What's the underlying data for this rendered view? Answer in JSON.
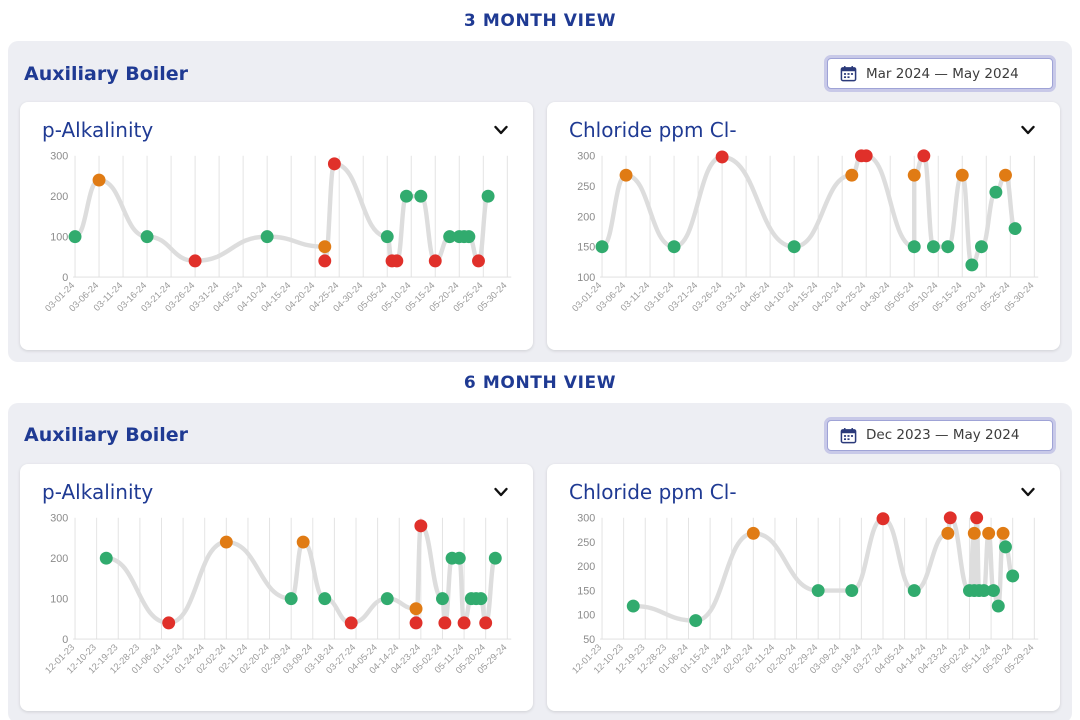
{
  "sections": [
    {
      "heading": "3 MONTH VIEW",
      "panel_title": "Auxiliary Boiler",
      "date_range": "Mar 2024 — May 2024",
      "charts": [
        {
          "title": "p-Alkalinity",
          "chevron": "chevron-down",
          "chart_data": {
            "type": "line",
            "title": "p-Alkalinity",
            "xlabel": "",
            "ylabel": "",
            "ylim": [
              0,
              300
            ],
            "yticks": [
              0,
              100,
              200,
              300
            ],
            "grid": true,
            "legend": "none",
            "xticks": [
              "03-01-24",
              "03-06-24",
              "03-11-24",
              "03-16-24",
              "03-21-24",
              "03-26-24",
              "03-31-24",
              "04-05-24",
              "04-10-24",
              "04-15-24",
              "04-20-24",
              "04-25-24",
              "04-30-24",
              "05-05-24",
              "05-10-24",
              "05-15-24",
              "05-20-24",
              "05-25-24",
              "05-30-24"
            ],
            "points": [
              {
                "x": "03-01-24",
                "y": 100,
                "status": "ok"
              },
              {
                "x": "03-06-24",
                "y": 240,
                "status": "warn"
              },
              {
                "x": "03-16-24",
                "y": 100,
                "status": "ok"
              },
              {
                "x": "03-26-24",
                "y": 40,
                "status": "alert"
              },
              {
                "x": "04-10-24",
                "y": 100,
                "status": "ok"
              },
              {
                "x": "04-22-24",
                "y": 75,
                "status": "warn"
              },
              {
                "x": "04-22-24",
                "y": 40,
                "status": "alert"
              },
              {
                "x": "04-24-24",
                "y": 280,
                "status": "alert"
              },
              {
                "x": "05-05-24",
                "y": 100,
                "status": "ok"
              },
              {
                "x": "05-06-24",
                "y": 40,
                "status": "alert"
              },
              {
                "x": "05-07-24",
                "y": 40,
                "status": "alert"
              },
              {
                "x": "05-09-24",
                "y": 200,
                "status": "ok"
              },
              {
                "x": "05-12-24",
                "y": 200,
                "status": "ok"
              },
              {
                "x": "05-15-24",
                "y": 40,
                "status": "alert"
              },
              {
                "x": "05-18-24",
                "y": 100,
                "status": "ok"
              },
              {
                "x": "05-20-24",
                "y": 100,
                "status": "ok"
              },
              {
                "x": "05-21-24",
                "y": 100,
                "status": "ok"
              },
              {
                "x": "05-22-24",
                "y": 100,
                "status": "ok"
              },
              {
                "x": "05-24-24",
                "y": 40,
                "status": "alert"
              },
              {
                "x": "05-26-24",
                "y": 200,
                "status": "ok"
              }
            ]
          }
        },
        {
          "title": "Chloride ppm Cl-",
          "chevron": "chevron-down",
          "chart_data": {
            "type": "line",
            "title": "Chloride ppm Cl-",
            "xlabel": "",
            "ylabel": "",
            "ylim": [
              100,
              300
            ],
            "yticks": [
              100,
              150,
              200,
              250,
              300
            ],
            "grid": true,
            "legend": "none",
            "xticks": [
              "03-01-24",
              "03-06-24",
              "03-11-24",
              "03-16-24",
              "03-21-24",
              "03-26-24",
              "03-31-24",
              "04-05-24",
              "04-10-24",
              "04-15-24",
              "04-20-24",
              "04-25-24",
              "04-30-24",
              "05-05-24",
              "05-10-24",
              "05-15-24",
              "05-20-24",
              "05-25-24",
              "05-30-24"
            ],
            "points": [
              {
                "x": "03-01-24",
                "y": 150,
                "status": "ok"
              },
              {
                "x": "03-06-24",
                "y": 268,
                "status": "warn"
              },
              {
                "x": "03-16-24",
                "y": 150,
                "status": "ok"
              },
              {
                "x": "03-26-24",
                "y": 298,
                "status": "alert"
              },
              {
                "x": "04-10-24",
                "y": 150,
                "status": "ok"
              },
              {
                "x": "04-22-24",
                "y": 268,
                "status": "warn"
              },
              {
                "x": "04-24-24",
                "y": 300,
                "status": "alert"
              },
              {
                "x": "04-25-24",
                "y": 300,
                "status": "alert"
              },
              {
                "x": "05-05-24",
                "y": 150,
                "status": "ok"
              },
              {
                "x": "05-05-24",
                "y": 268,
                "status": "warn"
              },
              {
                "x": "05-07-24",
                "y": 300,
                "status": "alert"
              },
              {
                "x": "05-09-24",
                "y": 150,
                "status": "ok"
              },
              {
                "x": "05-12-24",
                "y": 150,
                "status": "ok"
              },
              {
                "x": "05-15-24",
                "y": 268,
                "status": "warn"
              },
              {
                "x": "05-17-24",
                "y": 120,
                "status": "ok"
              },
              {
                "x": "05-19-24",
                "y": 150,
                "status": "ok"
              },
              {
                "x": "05-22-24",
                "y": 240,
                "status": "ok"
              },
              {
                "x": "05-24-24",
                "y": 268,
                "status": "warn"
              },
              {
                "x": "05-26-24",
                "y": 180,
                "status": "ok"
              }
            ]
          }
        }
      ]
    },
    {
      "heading": "6 MONTH VIEW",
      "panel_title": "Auxiliary Boiler",
      "date_range": "Dec 2023 — May 2024",
      "charts": [
        {
          "title": "p-Alkalinity",
          "chevron": "chevron-down",
          "chart_data": {
            "type": "line",
            "title": "p-Alkalinity",
            "xlabel": "",
            "ylabel": "",
            "ylim": [
              0,
              300
            ],
            "yticks": [
              0,
              100,
              200,
              300
            ],
            "grid": true,
            "legend": "none",
            "xticks": [
              "12-01-23",
              "12-10-23",
              "12-19-23",
              "12-28-23",
              "01-06-24",
              "01-15-24",
              "01-24-24",
              "02-02-24",
              "02-11-24",
              "02-20-24",
              "02-29-24",
              "03-09-24",
              "03-18-24",
              "03-27-24",
              "04-05-24",
              "04-14-24",
              "04-23-24",
              "05-02-24",
              "05-11-24",
              "05-20-24",
              "05-29-24"
            ],
            "points": [
              {
                "x": "12-14-23",
                "y": 200,
                "status": "ok"
              },
              {
                "x": "01-09-24",
                "y": 40,
                "status": "alert"
              },
              {
                "x": "02-02-24",
                "y": 240,
                "status": "warn"
              },
              {
                "x": "02-29-24",
                "y": 100,
                "status": "ok"
              },
              {
                "x": "03-05-24",
                "y": 240,
                "status": "warn"
              },
              {
                "x": "03-14-24",
                "y": 100,
                "status": "ok"
              },
              {
                "x": "03-25-24",
                "y": 40,
                "status": "alert"
              },
              {
                "x": "04-09-24",
                "y": 100,
                "status": "ok"
              },
              {
                "x": "04-21-24",
                "y": 75,
                "status": "warn"
              },
              {
                "x": "04-21-24",
                "y": 40,
                "status": "alert"
              },
              {
                "x": "04-23-24",
                "y": 280,
                "status": "alert"
              },
              {
                "x": "05-02-24",
                "y": 100,
                "status": "ok"
              },
              {
                "x": "05-03-24",
                "y": 40,
                "status": "alert"
              },
              {
                "x": "05-06-24",
                "y": 200,
                "status": "ok"
              },
              {
                "x": "05-09-24",
                "y": 200,
                "status": "ok"
              },
              {
                "x": "05-11-24",
                "y": 40,
                "status": "alert"
              },
              {
                "x": "05-14-24",
                "y": 100,
                "status": "ok"
              },
              {
                "x": "05-16-24",
                "y": 100,
                "status": "ok"
              },
              {
                "x": "05-18-24",
                "y": 100,
                "status": "ok"
              },
              {
                "x": "05-20-24",
                "y": 40,
                "status": "alert"
              },
              {
                "x": "05-24-24",
                "y": 200,
                "status": "ok"
              }
            ]
          }
        },
        {
          "title": "Chloride ppm Cl-",
          "chevron": "chevron-down",
          "chart_data": {
            "type": "line",
            "title": "Chloride ppm Cl-",
            "xlabel": "",
            "ylabel": "",
            "ylim": [
              50,
              300
            ],
            "yticks": [
              50,
              100,
              150,
              200,
              250,
              300
            ],
            "grid": true,
            "legend": "none",
            "xticks": [
              "12-01-23",
              "12-10-23",
              "12-19-23",
              "12-28-23",
              "01-06-24",
              "01-15-24",
              "01-24-24",
              "02-02-24",
              "02-11-24",
              "02-20-24",
              "02-29-24",
              "03-09-24",
              "03-18-24",
              "03-27-24",
              "04-05-24",
              "04-14-24",
              "04-23-24",
              "05-02-24",
              "05-11-24",
              "05-20-24",
              "05-29-24"
            ],
            "points": [
              {
                "x": "12-14-23",
                "y": 118,
                "status": "ok"
              },
              {
                "x": "01-09-24",
                "y": 88,
                "status": "ok"
              },
              {
                "x": "02-02-24",
                "y": 268,
                "status": "warn"
              },
              {
                "x": "02-29-24",
                "y": 150,
                "status": "ok"
              },
              {
                "x": "03-14-24",
                "y": 150,
                "status": "ok"
              },
              {
                "x": "03-27-24",
                "y": 298,
                "status": "alert"
              },
              {
                "x": "04-09-24",
                "y": 150,
                "status": "ok"
              },
              {
                "x": "04-23-24",
                "y": 268,
                "status": "warn"
              },
              {
                "x": "04-24-24",
                "y": 300,
                "status": "alert"
              },
              {
                "x": "05-02-24",
                "y": 150,
                "status": "ok"
              },
              {
                "x": "05-04-24",
                "y": 268,
                "status": "warn"
              },
              {
                "x": "05-04-24",
                "y": 150,
                "status": "ok"
              },
              {
                "x": "05-05-24",
                "y": 300,
                "status": "alert"
              },
              {
                "x": "05-06-24",
                "y": 150,
                "status": "ok"
              },
              {
                "x": "05-08-24",
                "y": 150,
                "status": "ok"
              },
              {
                "x": "05-10-24",
                "y": 268,
                "status": "warn"
              },
              {
                "x": "05-12-24",
                "y": 150,
                "status": "ok"
              },
              {
                "x": "05-14-24",
                "y": 118,
                "status": "ok"
              },
              {
                "x": "05-16-24",
                "y": 268,
                "status": "warn"
              },
              {
                "x": "05-17-24",
                "y": 240,
                "status": "ok"
              },
              {
                "x": "05-20-24",
                "y": 180,
                "status": "ok"
              }
            ]
          }
        }
      ]
    }
  ],
  "colors": {
    "ok": "#31AB6E",
    "warn": "#E07B14",
    "alert": "#E0302A",
    "line": "#DDDDDD",
    "accent": "#1F3A93",
    "panel_bg": "#EDEEF3"
  },
  "icons": {
    "calendar": "calendar-icon",
    "chevron_down": "chevron-down-icon"
  }
}
